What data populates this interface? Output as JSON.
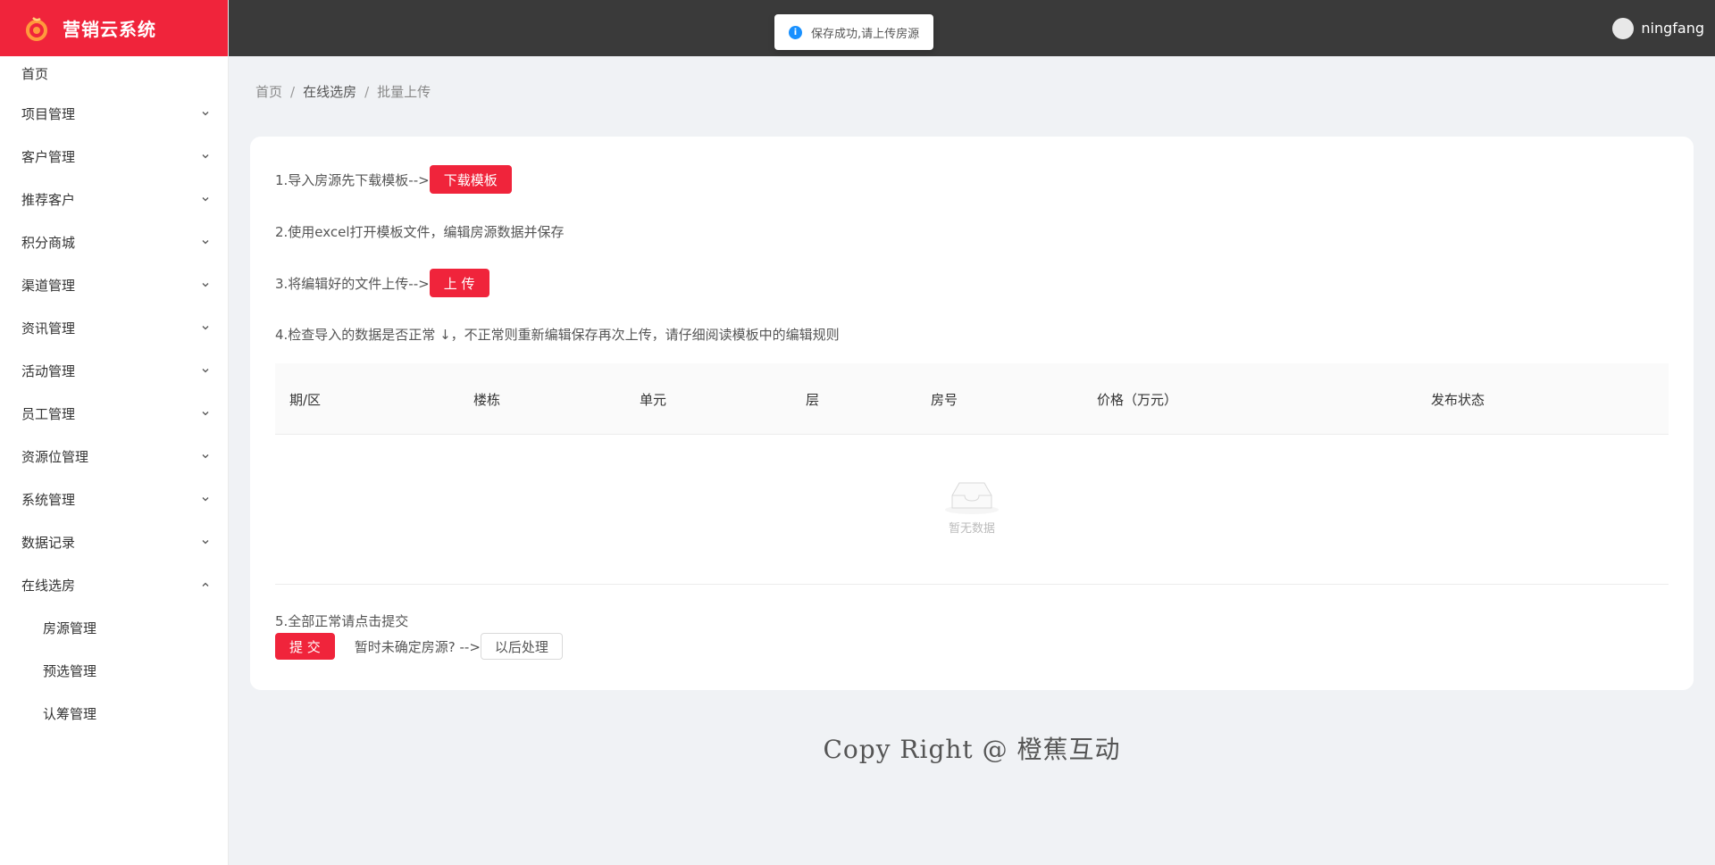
{
  "app": {
    "title": "营销云系统"
  },
  "user": {
    "name": "ningfang"
  },
  "toast": {
    "message": "保存成功,请上传房源"
  },
  "sidebar": {
    "home": "首页",
    "groups": [
      {
        "label": "项目管理",
        "expanded": false
      },
      {
        "label": "客户管理",
        "expanded": false
      },
      {
        "label": "推荐客户",
        "expanded": false
      },
      {
        "label": "积分商城",
        "expanded": false
      },
      {
        "label": "渠道管理",
        "expanded": false
      },
      {
        "label": "资讯管理",
        "expanded": false
      },
      {
        "label": "活动管理",
        "expanded": false
      },
      {
        "label": "员工管理",
        "expanded": false
      },
      {
        "label": "资源位管理",
        "expanded": false
      },
      {
        "label": "系统管理",
        "expanded": false
      },
      {
        "label": "数据记录",
        "expanded": false
      },
      {
        "label": "在线选房",
        "expanded": true
      }
    ],
    "subitems": [
      "房源管理",
      "预选管理",
      "认筹管理"
    ]
  },
  "breadcrumb": {
    "home": "首页",
    "parent": "在线选房",
    "current": "批量上传",
    "sep": "/"
  },
  "steps": {
    "s1": "1.导入房源先下载模板-->",
    "s1_button": "下载模板",
    "s2": "2.使用excel打开模板文件，编辑房源数据并保存",
    "s3": "3.将编辑好的文件上传-->",
    "s3_button": "上 传",
    "s4": "4.检查导入的数据是否正常 ↓，不正常则重新编辑保存再次上传，请仔细阅读模板中的编辑规则",
    "s5": "5.全部正常请点击提交",
    "submit_button": "提 交",
    "later_prompt": "暂时未确定房源? -->",
    "later_button": "以后处理"
  },
  "table": {
    "columns": [
      "期/区",
      "楼栋",
      "单元",
      "层",
      "房号",
      "价格（万元）",
      "发布状态"
    ],
    "rows": [],
    "empty_text": "暂无数据"
  },
  "footer": {
    "text": "Copy Right @ 橙蕉互动"
  },
  "colors": {
    "brand": "#f0243b",
    "topbar": "#3a3a3a",
    "info": "#1890ff"
  }
}
